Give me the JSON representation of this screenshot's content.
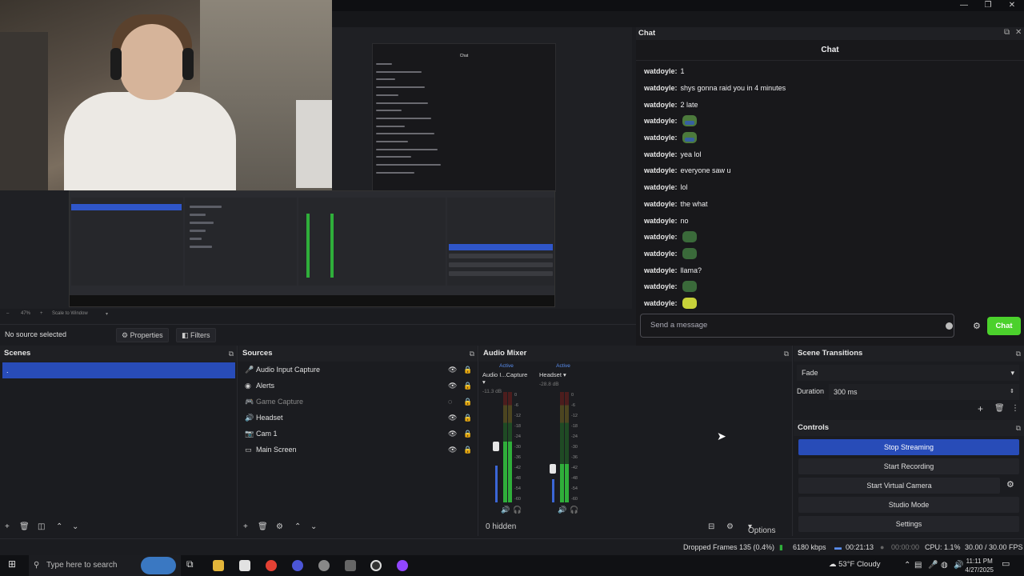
{
  "window": {
    "minimize": "—",
    "maximize": "❐",
    "close": "✕"
  },
  "chat_dock": {
    "dock_title": "Chat",
    "header": "Chat",
    "messages": [
      {
        "user": "watdoyle:",
        "text": "1",
        "emote": null
      },
      {
        "user": "watdoyle:",
        "text": "shys gonna raid you in 4 minutes",
        "emote": null
      },
      {
        "user": "watdoyle:",
        "text": "2 late",
        "emote": null
      },
      {
        "user": "watdoyle:",
        "text": "",
        "emote": "frog"
      },
      {
        "user": "watdoyle:",
        "text": "",
        "emote": "frog"
      },
      {
        "user": "watdoyle:",
        "text": "yea lol",
        "emote": null
      },
      {
        "user": "watdoyle:",
        "text": "everyone saw u",
        "emote": null
      },
      {
        "user": "watdoyle:",
        "text": "lol",
        "emote": null
      },
      {
        "user": "watdoyle:",
        "text": "the what",
        "emote": null
      },
      {
        "user": "watdoyle:",
        "text": "no",
        "emote": null
      },
      {
        "user": "watdoyle:",
        "text": "",
        "emote": "green"
      },
      {
        "user": "watdoyle:",
        "text": "",
        "emote": "green"
      },
      {
        "user": "watdoyle:",
        "text": "llama?",
        "emote": null
      },
      {
        "user": "watdoyle:",
        "text": "",
        "emote": "green"
      },
      {
        "user": "watdoyle:",
        "text": "",
        "emote": "yellow"
      }
    ],
    "input_placeholder": "Send a message",
    "send_label": "Chat"
  },
  "preview_bar": {
    "zoom": "47%",
    "scale": "Scale to Window"
  },
  "source_toolbar": {
    "no_source": "No source selected",
    "properties": "Properties",
    "filters": "Filters"
  },
  "scenes": {
    "title": "Scenes",
    "selected": "."
  },
  "sources": {
    "title": "Sources",
    "items": [
      {
        "icon": "mic-icon",
        "glyph": "🎤",
        "name": "Audio Input Capture",
        "visible": true
      },
      {
        "icon": "globe-icon",
        "glyph": "◉",
        "name": "Alerts",
        "visible": true
      },
      {
        "icon": "gamepad-icon",
        "glyph": "🎮",
        "name": "Game Capture",
        "visible": false
      },
      {
        "icon": "speaker-icon",
        "glyph": "🔊",
        "name": "Headset",
        "visible": true
      },
      {
        "icon": "camera-icon",
        "glyph": "📷",
        "name": "Cam 1",
        "visible": true
      },
      {
        "icon": "monitor-icon",
        "glyph": "▭",
        "name": "Main Screen",
        "visible": true
      }
    ]
  },
  "audio_mixer": {
    "title": "Audio Mixer",
    "channels": [
      {
        "status": "Active",
        "name": "Audio I...Capture",
        "db": "-11.3 dB",
        "level": 0.55
      },
      {
        "status": "Active",
        "name": "Headset",
        "db": "-28.8 dB",
        "level": 0.35
      }
    ],
    "scale_marks": [
      "0",
      "-6",
      "-12",
      "-18",
      "-24",
      "-30",
      "-36",
      "-42",
      "-48",
      "-54",
      "-60"
    ],
    "hidden": "0 hidden",
    "options": "Options"
  },
  "transitions": {
    "title": "Scene Transitions",
    "type": "Fade",
    "duration_label": "Duration",
    "duration": "300 ms"
  },
  "controls": {
    "title": "Controls",
    "buttons": [
      "Stop Streaming",
      "Start Recording",
      "Start Virtual Camera",
      "Studio Mode",
      "Settings"
    ]
  },
  "status_bar": {
    "dropped": "Dropped Frames 135 (0.4%)",
    "kbps": "6180 kbps",
    "live": "00:21:13",
    "rec": "00:00:00",
    "cpu": "CPU: 1.1%",
    "fps": "30.00 / 30.00 FPS"
  },
  "taskbar": {
    "search_placeholder": "Type here to search",
    "weather": "53°F  Cloudy",
    "time": "11:11 PM",
    "date": "4/27/2025"
  },
  "colors": {
    "accent": "#284cb8",
    "twitch_green": "#4bd12c",
    "meter_green": "#2fae3a",
    "meter_red": "#b02020"
  }
}
